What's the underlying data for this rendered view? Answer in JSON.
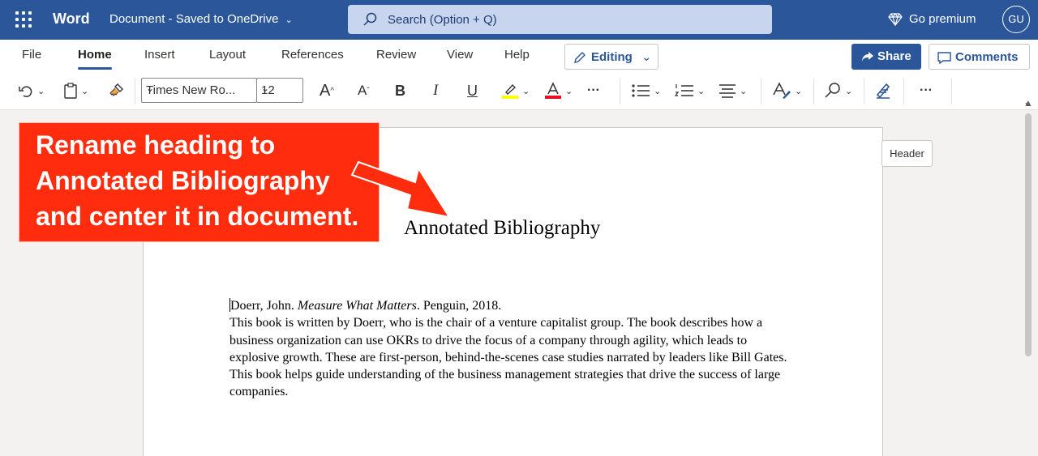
{
  "titlebar": {
    "app_name": "Word",
    "doc_title": "Document - Saved to OneDrive",
    "search_placeholder": "Search (Option + Q)",
    "premium_label": "Go premium",
    "avatar_initials": "GU",
    "bg_color": "#2b579a"
  },
  "ribbon": {
    "tabs": [
      "File",
      "Home",
      "Insert",
      "Layout",
      "References",
      "Review",
      "View",
      "Help"
    ],
    "active_tab": "Home",
    "editing_label": "Editing",
    "share_label": "Share",
    "comments_label": "Comments",
    "font_name": "Times New Ro...",
    "font_size": "12",
    "bold_glyph": "B",
    "italic_glyph": "I",
    "underline_glyph": "U",
    "grow_font_glyph": "A",
    "shrink_font_glyph": "A",
    "highlight_color": "#ffff00",
    "font_color": "#e81123",
    "more_label": "···"
  },
  "document": {
    "header_button": "Header",
    "heading": "Annotated Bibliography",
    "citation_author": "Doerr, John. ",
    "citation_title": "Measure What Matters",
    "citation_rest": ". Penguin, 2018.",
    "annotation": "This book is written by Doerr, who is the chair of a venture capitalist group. The book describes how a business organization can use OKRs to drive the focus of a company through agility, which leads to explosive growth. These are first-person, behind-the-scenes case studies narrated by leaders like Bill Gates. This book helps guide understanding of the business management strategies that drive the success of large companies."
  },
  "callout": {
    "line1": "Rename heading to",
    "line2": "Annotated Bibliography",
    "line3": "and center it in document.",
    "color": "#ff2d0d"
  }
}
